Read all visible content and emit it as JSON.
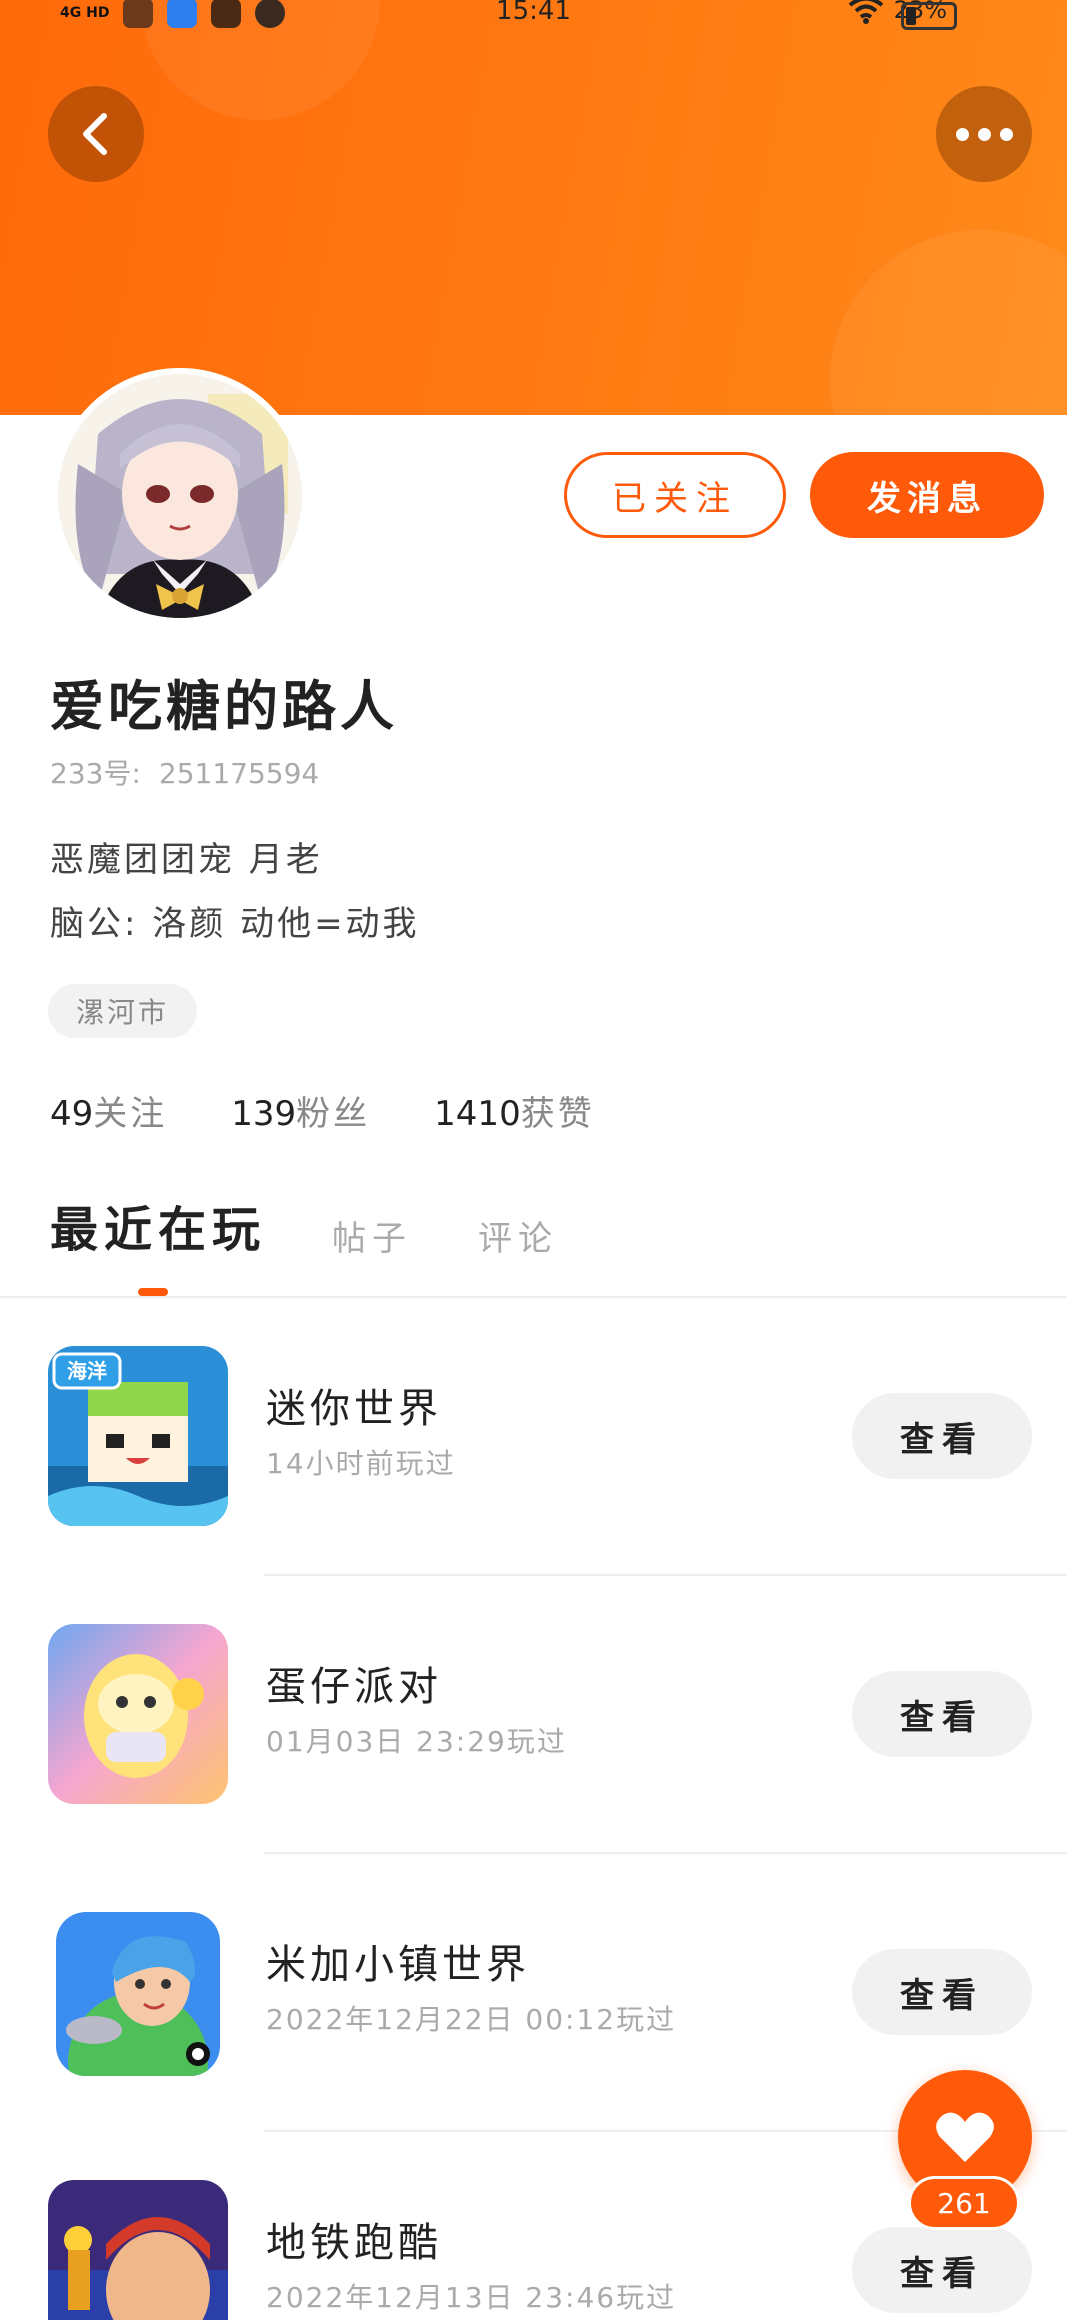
{
  "status_bar": {
    "signal": "4G HD",
    "time": "15:41",
    "battery": "23%"
  },
  "profile": {
    "username": "爱吃糖的路人",
    "uid_label": "233号:",
    "uid": "251175594",
    "bio_line1": "恶魔团团宠  月老",
    "bio_line2": "脑公: 洛颜  动他=动我",
    "location": "漯河市",
    "follow_button": "已关注",
    "message_button": "发消息"
  },
  "stats": [
    {
      "num": "49",
      "label": "关注"
    },
    {
      "num": "139",
      "label": "粉丝"
    },
    {
      "num": "1410",
      "label": "获赞"
    }
  ],
  "tabs": [
    "最近在玩",
    "帖子",
    "评论"
  ],
  "games": [
    {
      "name": "迷你世界",
      "time": "14小时前玩过",
      "button": "查看",
      "icon_badge": "海洋"
    },
    {
      "name": "蛋仔派对",
      "time": "01月03日  23:29玩过",
      "button": "查看"
    },
    {
      "name": "米加小镇世界",
      "time": "2022年12月22日  00:12玩过",
      "button": "查看"
    },
    {
      "name": "地铁跑酷",
      "time": "2022年12月13日  23:46玩过",
      "button": "查看"
    }
  ],
  "like": {
    "count": "261"
  },
  "colors": {
    "accent": "#ff5a0a",
    "header_gradient_start": "#ff6a0a",
    "header_gradient_end": "#ff8a1a"
  }
}
